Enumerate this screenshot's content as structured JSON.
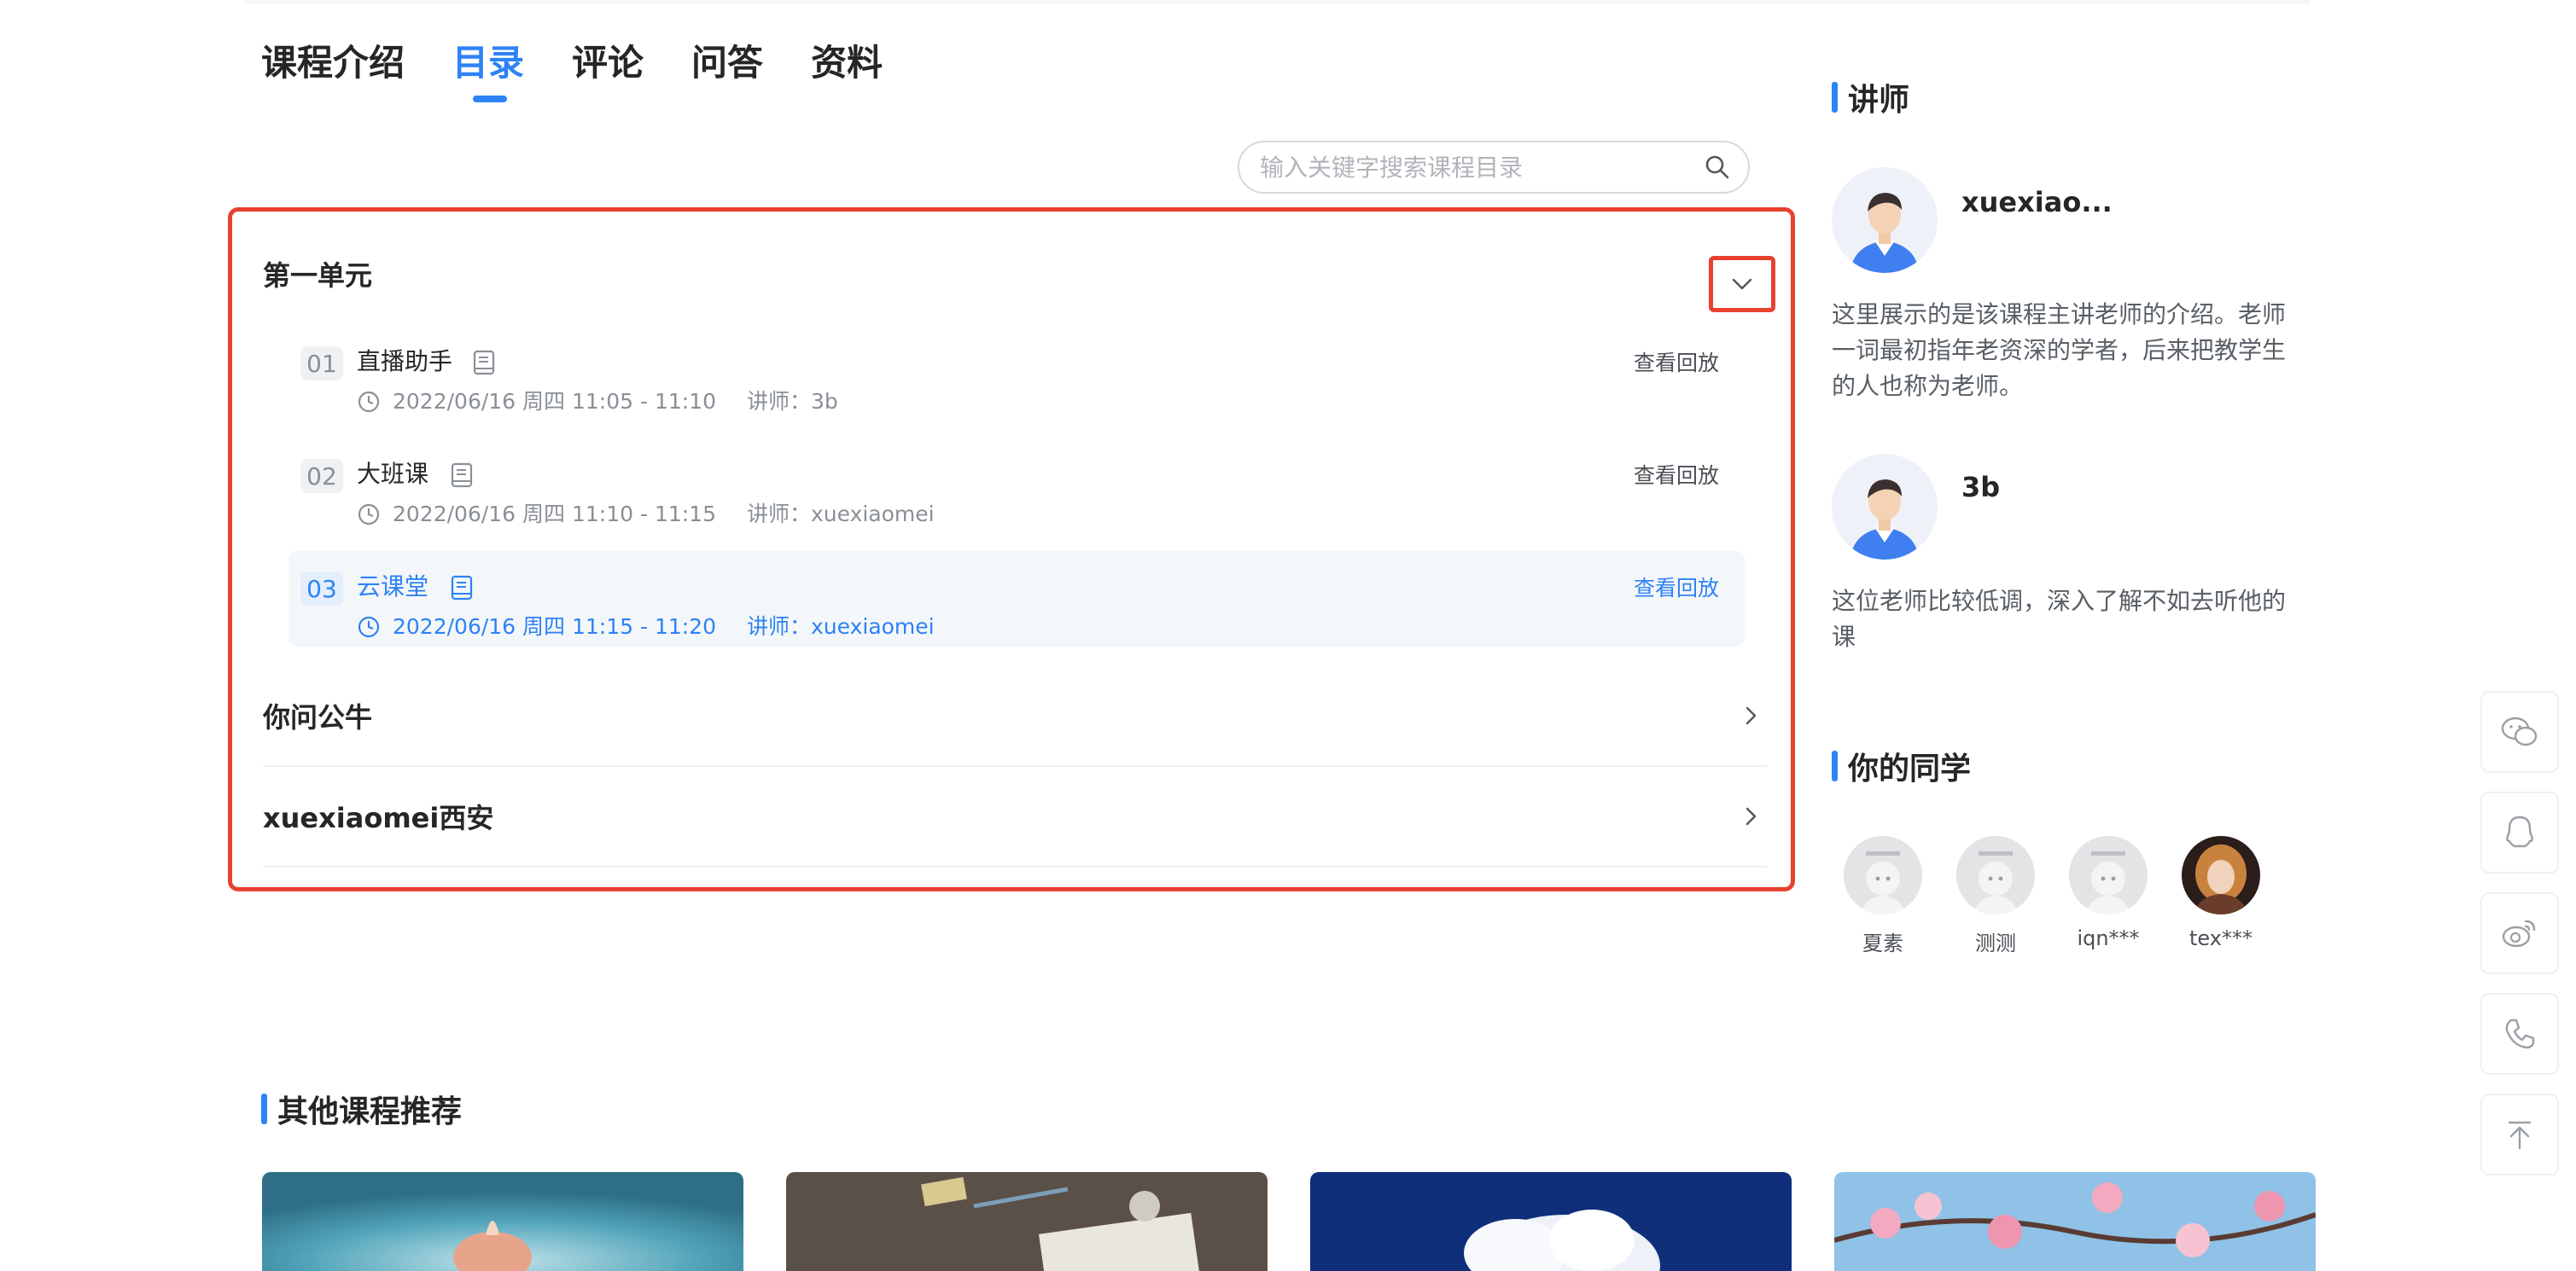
{
  "tabs": [
    {
      "label": "课程介绍",
      "active": false
    },
    {
      "label": "目录",
      "active": true
    },
    {
      "label": "评论",
      "active": false
    },
    {
      "label": "问答",
      "active": false
    },
    {
      "label": "资料",
      "active": false
    }
  ],
  "search": {
    "placeholder": "输入关键字搜索课程目录"
  },
  "catalog": {
    "unit_title": "第一单元",
    "lessons": [
      {
        "num": "01",
        "title": "直播助手",
        "time": "2022/06/16 周四 11:05 - 11:10",
        "teacher": "讲师：3b",
        "action": "查看回放"
      },
      {
        "num": "02",
        "title": "大班课",
        "time": "2022/06/16 周四 11:10 - 11:15",
        "teacher": "讲师：xuexiaomei",
        "action": "查看回放"
      },
      {
        "num": "03",
        "title": "云课堂",
        "time": "2022/06/16 周四 11:15 - 11:20",
        "teacher": "讲师：xuexiaomei",
        "action": "查看回放"
      }
    ],
    "sections": [
      "你问公牛",
      "xuexiaomei西安"
    ]
  },
  "sidebar": {
    "teachers_title": "讲师",
    "teachers": [
      {
        "name": "xuexiao...",
        "desc": "这里展示的是该课程主讲老师的介绍。老师一词最初指年老资深的学者，后来把教学生的人也称为老师。"
      },
      {
        "name": "3b",
        "desc": "这位老师比较低调，深入了解不如去听他的课"
      }
    ],
    "classmates_title": "你的同学",
    "classmates": [
      "夏素",
      "测测",
      "iqn***",
      "tex***"
    ]
  },
  "recommend": {
    "title": "其他课程推荐"
  },
  "colors": {
    "accent": "#2d82f5",
    "highlight_border": "#e8412f"
  }
}
